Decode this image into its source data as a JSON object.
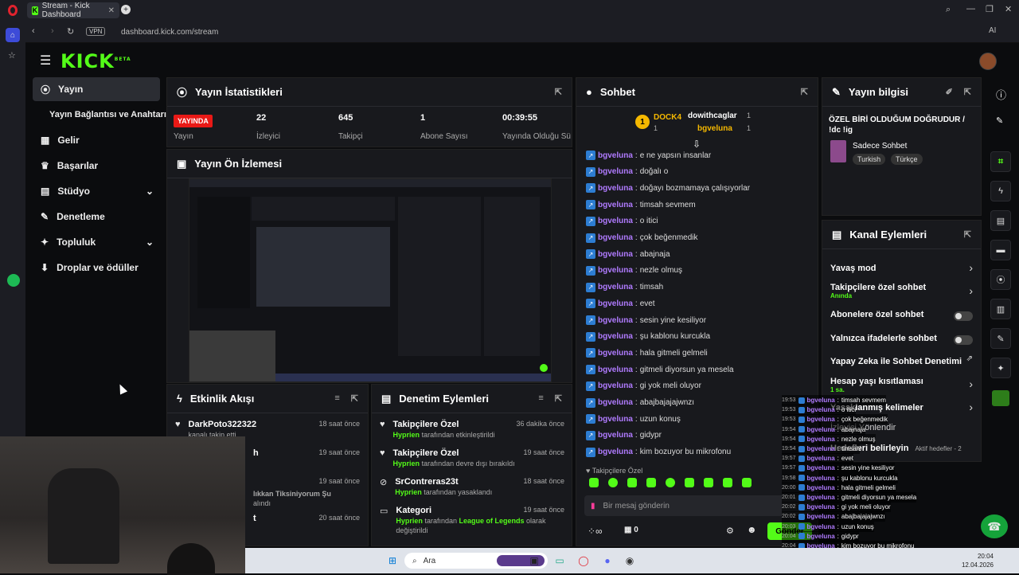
{
  "browser": {
    "tab_title": "Stream - Kick Dashboard",
    "url": "dashboard.kick.com/stream",
    "vpn_label": "VPN",
    "ai_label": "AI"
  },
  "kick": {
    "logo": "KICK",
    "logo_beta": "BETA"
  },
  "nav": {
    "items": [
      {
        "label": "Yayın",
        "icon": "broadcast-icon"
      },
      {
        "label": "Yayın Bağlantısı ve Anahtarı",
        "icon": ""
      },
      {
        "label": "Gelir",
        "icon": "dollar-icon"
      },
      {
        "label": "Başarılar",
        "icon": "trophy-icon"
      },
      {
        "label": "Stüdyo",
        "icon": "studio-icon"
      },
      {
        "label": "Denetleme",
        "icon": "moderation-icon"
      },
      {
        "label": "Topluluk",
        "icon": "community-icon"
      },
      {
        "label": "Droplar ve ödüller",
        "icon": "drops-icon"
      }
    ]
  },
  "stats": {
    "title": "Yayın İstatistikleri",
    "live_badge": "YAYINDA",
    "live_label": "Yayın",
    "items": [
      {
        "value": "22",
        "label": "İzleyici"
      },
      {
        "value": "645",
        "label": "Takipçi"
      },
      {
        "value": "1",
        "label": "Abone Sayısı"
      },
      {
        "value": "00:39:55",
        "label": "Yayında Olduğu Süre"
      }
    ]
  },
  "preview": {
    "title": "Yayın Ön İzlemesi"
  },
  "activity": {
    "title": "Etkinlik Akışı",
    "items": [
      {
        "name": "DarkPoto322322",
        "desc": "kanalı takip etti",
        "time": "18 saat önce"
      },
      {
        "name": "h",
        "desc": "",
        "time": "19 saat önce"
      },
      {
        "name": "",
        "desc": "lıkkan Tiksiniyorum Şu",
        "desc2": "alındı",
        "time": "19 saat önce"
      },
      {
        "name": "t",
        "desc": "",
        "time": "20 saat önce"
      }
    ]
  },
  "mod_actions": {
    "title": "Denetim Eylemleri",
    "items": [
      {
        "title": "Takipçilere Özel",
        "user": "Hyprien",
        "desc": "tarafından etkinleştirildi",
        "time": "36 dakika önce"
      },
      {
        "title": "Takipçilere Özel",
        "user": "Hyprien",
        "desc": "tarafından devre dışı bırakıldı",
        "time": "19 saat önce"
      },
      {
        "title": "SrContreras23t",
        "user": "Hyprien",
        "desc": "tarafından yasaklandı",
        "time": "18 saat önce"
      },
      {
        "title": "Kategori",
        "user": "Hyprien",
        "desc": "tarafından",
        "highlight": "League of Legends",
        "desc2": "olarak",
        "desc3": "değiştirildi",
        "time": "19 saat önce"
      }
    ]
  },
  "chat": {
    "title": "Sohbet",
    "top_gifters": [
      {
        "name": "DOCK4",
        "count": "1"
      },
      {
        "name": "dowithcaglar",
        "count": "1"
      },
      {
        "name": "bgveluna",
        "count": "1"
      }
    ],
    "rank": "1",
    "user": "bgveluna",
    "messages": [
      "e ne yapsın insanlar",
      "doğalı o",
      "doğayı bozmamaya çalışıyorlar",
      "timsah sevmem",
      "o itici",
      "çok beğenmedik",
      "abajnaja",
      "nezle olmuş",
      "timsah",
      "evet",
      "sesin yine kesiliyor",
      "şu kablonu kurcukla",
      "hala gitmeli gelmeli",
      "gitmeli diyorsun ya mesela",
      "gi yok meli oluyor",
      "abajbajajajwnzı",
      "uzun konuş",
      "gidypr",
      "kim bozuyor bu mikrofonu"
    ],
    "followers_only": "Takipçilere Özel",
    "input_placeholder": "Bir mesaj gönderin",
    "send_label": "Gönder",
    "count": "0"
  },
  "stream_info": {
    "title": "Yayın bilgisi",
    "stream_title": "ÖZEL BİRİ OLDUĞUM DOĞRUDUR / !dc !ig",
    "category": "Sadece Sohbet",
    "tags": [
      "Turkish",
      "Türkçe"
    ]
  },
  "channel_actions": {
    "title": "Kanal Eylemleri",
    "items": [
      {
        "label": "Yavaş mod",
        "sub": "",
        "control": "chevron"
      },
      {
        "label": "Takipçilere özel sohbet",
        "sub": "Anında",
        "control": "chevron"
      },
      {
        "label": "Abonelere özel sohbet",
        "sub": "",
        "control": "toggle"
      },
      {
        "label": "Yalnızca ifadelerle sohbet",
        "sub": "",
        "control": "toggle"
      },
      {
        "label": "Yapay Zeka ile Sohbet Denetimi",
        "sub": "",
        "control": "external"
      },
      {
        "label": "Hesap yaşı kısıtlaması",
        "sub": "1 sa.",
        "control": "chevron"
      },
      {
        "label": "Yasaklanmış kelimeler",
        "sub": "",
        "control": "chevron"
      },
      {
        "label": "İzleyici Yönlendir",
        "sub": "",
        "control": ""
      },
      {
        "label": "Hedefleri belirleyin",
        "sub": "Aktif hedefler - 2",
        "control": "chevron"
      }
    ]
  },
  "overlay_chat": [
    {
      "time": "19:53",
      "msg": "timsah sevmem"
    },
    {
      "time": "19:53",
      "msg": "o itici"
    },
    {
      "time": "19:53",
      "msg": "çok beğenmedik"
    },
    {
      "time": "19:54",
      "msg": "abajnaja"
    },
    {
      "time": "19:54",
      "msg": "nezle olmuş"
    },
    {
      "time": "19:54",
      "msg": "timsah"
    },
    {
      "time": "19:57",
      "msg": "evet"
    },
    {
      "time": "19:57",
      "msg": "sesin yine kesiliyor"
    },
    {
      "time": "19:58",
      "msg": "şu kablonu kurcukla"
    },
    {
      "time": "20:00",
      "msg": "hala gitmeli gelmeli"
    },
    {
      "time": "20:01",
      "msg": "gitmeli diyorsun ya mesela"
    },
    {
      "time": "20:02",
      "msg": "gi yok meli oluyor"
    },
    {
      "time": "20:02",
      "msg": "abajbajajajwnzı"
    },
    {
      "time": "20:03",
      "msg": "uzun konuş"
    },
    {
      "time": "20:04",
      "msg": "gidypr"
    },
    {
      "time": "20:04",
      "msg": "kim bozuyor bu mikrofonu"
    }
  ],
  "taskbar": {
    "search_label": "Ara",
    "clock": "20:04",
    "date": "12.04.2026"
  },
  "colors": {
    "accent": "#53fc18",
    "live": "#e91916",
    "username": "#b07bff"
  }
}
